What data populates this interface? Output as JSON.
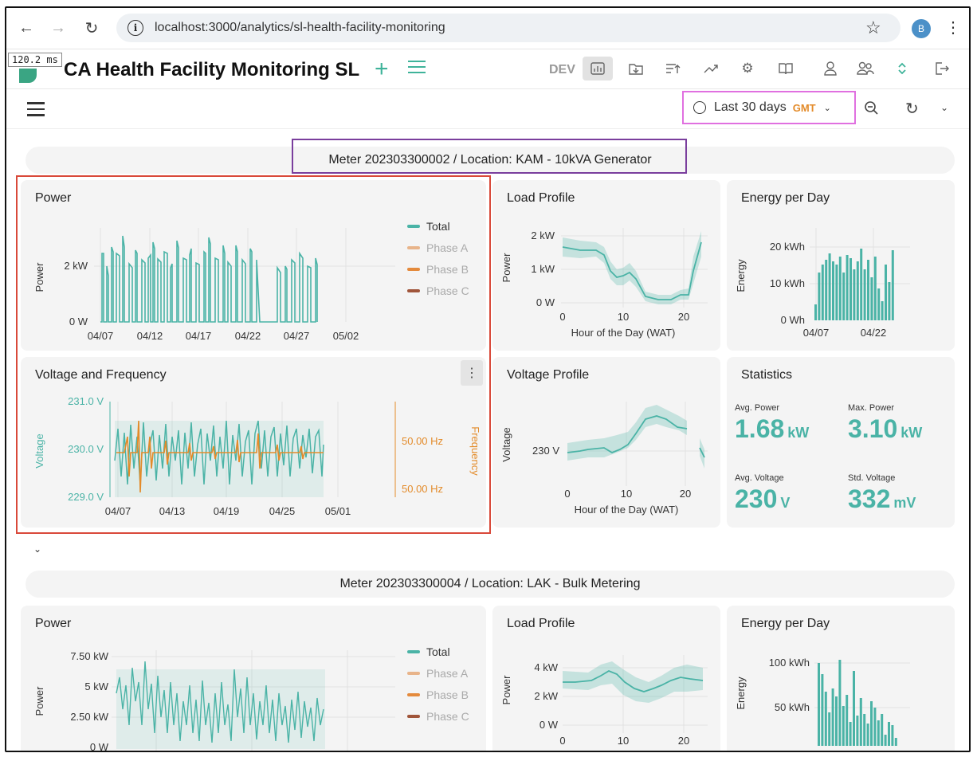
{
  "browser": {
    "url": "localhost:3000/analytics/sl-health-facility-monitoring",
    "profile_initial": "B",
    "back_icon": "arrow-left-icon",
    "forward_icon": "arrow-right-icon",
    "reload_icon": "reload-icon"
  },
  "app": {
    "perf_badge": "120.2 ms",
    "title": "CA Health Facility Monitoring SL",
    "env_label": "DEV",
    "accent_color": "#3fb39a"
  },
  "toolbar": {
    "time_range": "Last 30 days",
    "timezone": "GMT"
  },
  "meters": [
    {
      "heading": "Meter 202303300002 / Location: KAM - 10kVA Generator",
      "power": {
        "title": "Power",
        "ylabel": "Power",
        "yticks": [
          "2 kW",
          "0 W"
        ],
        "xticks": [
          "04/07",
          "04/12",
          "04/17",
          "04/22",
          "04/27",
          "05/02"
        ],
        "legend": [
          "Total",
          "Phase A",
          "Phase B",
          "Phase C"
        ]
      },
      "voltage_freq": {
        "title": "Voltage and Frequency",
        "ylabel_left": "Voltage",
        "ylabel_right": "Frequency",
        "yticks_left": [
          "231.0 V",
          "230.0 V",
          "229.0 V"
        ],
        "yticks_right": [
          "50.00 Hz",
          "50.00 Hz"
        ],
        "xticks": [
          "04/07",
          "04/13",
          "04/19",
          "04/25",
          "05/01"
        ]
      },
      "load_profile": {
        "title": "Load Profile",
        "ylabel": "Power",
        "xlabel": "Hour of the Day (WAT)",
        "yticks": [
          "2 kW",
          "1 kW",
          "0 W"
        ],
        "xticks": [
          "0",
          "10",
          "20"
        ]
      },
      "energy": {
        "title": "Energy per Day",
        "ylabel": "Energy",
        "yticks": [
          "20 kWh",
          "10 kWh",
          "0 Wh"
        ],
        "xticks": [
          "04/07",
          "04/22"
        ]
      },
      "voltage_profile": {
        "title": "Voltage Profile",
        "ylabel": "Voltage",
        "xlabel": "Hour of the Day (WAT)",
        "yticks": [
          "230 V"
        ],
        "xticks": [
          "0",
          "10",
          "20"
        ]
      },
      "statistics": {
        "title": "Statistics",
        "items": [
          {
            "label": "Avg. Power",
            "value": "1.68",
            "unit": "kW"
          },
          {
            "label": "Max. Power",
            "value": "3.10",
            "unit": "kW"
          },
          {
            "label": "Avg. Voltage",
            "value": "230",
            "unit": "V"
          },
          {
            "label": "Std. Voltage",
            "value": "332",
            "unit": "mV"
          }
        ]
      }
    },
    {
      "heading": "Meter 202303300004 / Location: LAK - Bulk Metering",
      "power": {
        "title": "Power",
        "ylabel": "Power",
        "yticks": [
          "7.50 kW",
          "5 kW",
          "2.50 kW",
          "0 W"
        ],
        "legend": [
          "Total",
          "Phase A",
          "Phase B",
          "Phase C"
        ]
      },
      "load_profile": {
        "title": "Load Profile",
        "ylabel": "Power",
        "yticks": [
          "4 kW",
          "2 kW",
          "0 W"
        ],
        "xticks": [
          "0",
          "10",
          "20"
        ]
      },
      "energy": {
        "title": "Energy per Day",
        "ylabel": "Energy",
        "yticks": [
          "100 kWh",
          "50 kWh"
        ]
      }
    }
  ],
  "colors": {
    "total": "#4ab3a6",
    "phase_a": "#e8b48a",
    "phase_b": "#e48a3c",
    "phase_c": "#a0553a",
    "frequency": "#e38b2a",
    "highlight_red": "#d9493a",
    "highlight_purple": "#7a3e9d",
    "highlight_pink": "#e070e0"
  }
}
